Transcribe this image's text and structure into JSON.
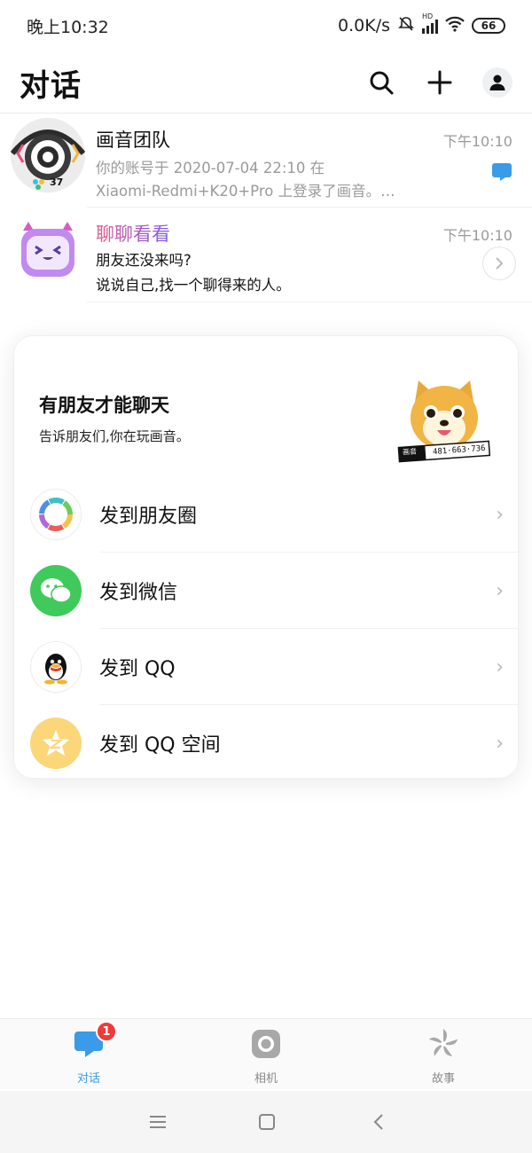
{
  "status_bar": {
    "time": "晚上10:32",
    "speed": "0.0K/s",
    "network": "HD",
    "battery": "66"
  },
  "header": {
    "title": "对话",
    "icons": [
      "search-icon",
      "plus-icon",
      "profile-icon"
    ]
  },
  "conversations": [
    {
      "name": "画音团队",
      "time": "下午10:10",
      "line1": "你的账号于 2020-07-04 22:10 在",
      "line2": "Xiaomi-Redmi+K20+Pro 上登录了画音。…",
      "avatar_badge": "37",
      "indicator": "message-bubble-icon"
    },
    {
      "name": "聊聊看看",
      "time": "下午10:10",
      "line1": "朋友还没来吗?",
      "line2": "说说自己,找一个聊得来的人。",
      "indicator": "chevron-right-icon"
    }
  ],
  "share_card": {
    "title": "有朋友才能聊天",
    "subtitle": "告诉朋友们,你在玩画音。",
    "dog_tag_brand": "画音",
    "dog_tag_id": "481·663·736",
    "items": [
      {
        "label": "发到朋友圈",
        "icon": "moments-icon"
      },
      {
        "label": "发到微信",
        "icon": "wechat-icon"
      },
      {
        "label": "发到 QQ",
        "icon": "qq-icon"
      },
      {
        "label": "发到 QQ 空间",
        "icon": "qzone-icon"
      }
    ]
  },
  "tabs": [
    {
      "label": "对话",
      "icon": "chat-icon",
      "badge": "1",
      "active": true
    },
    {
      "label": "相机",
      "icon": "camera-icon",
      "active": false
    },
    {
      "label": "故事",
      "icon": "pinwheel-icon",
      "active": false
    }
  ],
  "colors": {
    "accent": "#3a9be8",
    "badge": "#f03a3a",
    "wechat": "#3fca5b",
    "qzone": "#fbd77a",
    "muted": "#9a9a9a"
  }
}
